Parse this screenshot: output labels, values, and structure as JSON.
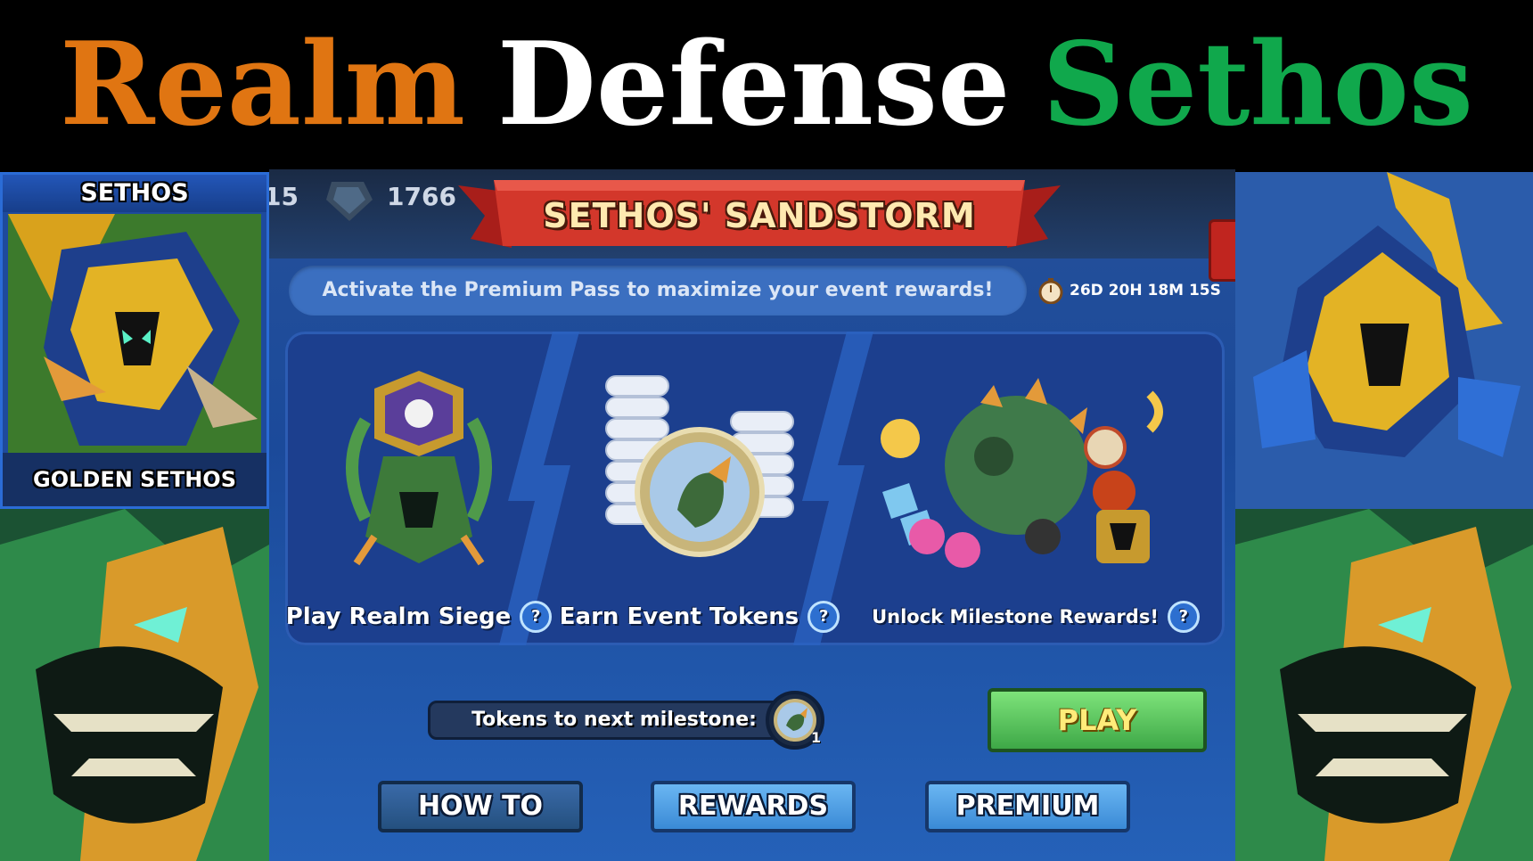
{
  "banner": {
    "word1": "Realm",
    "word2": "Defense",
    "word3": "Sethos",
    "colors": {
      "word1": "#e07512",
      "word2": "#ffffff",
      "word3": "#10a84c"
    }
  },
  "left_card": {
    "title": "SETHOS",
    "skin_name": "GOLDEN SETHOS"
  },
  "top_bar": {
    "left_count": "15",
    "gems": "1766"
  },
  "event": {
    "title": "SETHOS' SANDSTORM",
    "info": "Activate the Premium Pass to maximize your event rewards!",
    "timer": "26D 20H 18M 15S"
  },
  "columns": [
    {
      "label": "Play Realm Siege",
      "icon": "realm-siege-crest-icon"
    },
    {
      "label": "Earn Event Tokens",
      "icon": "event-tokens-icon"
    },
    {
      "label": "Unlock Milestone Rewards!",
      "icon": "milestone-rewards-icon"
    }
  ],
  "progress": {
    "label": "Tokens to next milestone:",
    "token_count": "1",
    "fraction": 0.0
  },
  "buttons": {
    "play": "PLAY",
    "how_to": "HOW TO",
    "rewards": "REWARDS",
    "premium": "PREMIUM"
  }
}
